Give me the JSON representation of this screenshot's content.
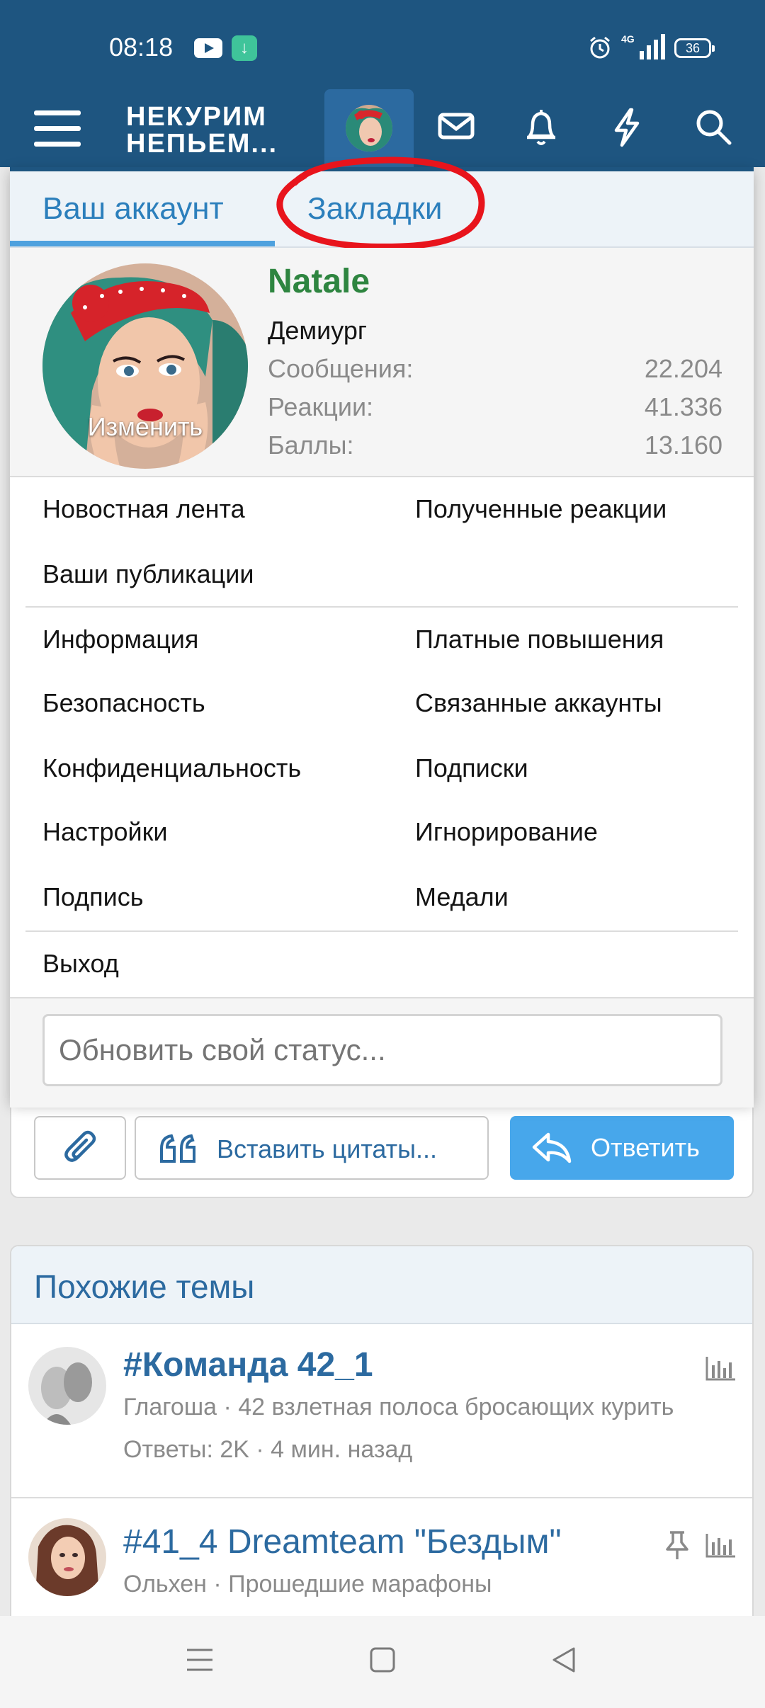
{
  "status_bar": {
    "time": "08:18",
    "battery": "36"
  },
  "header": {
    "logo_line1": "НЕКУРИМ",
    "logo_line2": "НЕПЬЕМ..."
  },
  "popup": {
    "tabs": {
      "account": "Ваш аккаунт",
      "bookmarks": "Закладки"
    },
    "profile": {
      "change_label": "Изменить",
      "username": "Natale",
      "user_title": "Демиург",
      "stats": [
        {
          "label": "Сообщения:",
          "value": "22.204"
        },
        {
          "label": "Реакции:",
          "value": "41.336"
        },
        {
          "label": "Баллы:",
          "value": "13.160"
        }
      ]
    },
    "links": {
      "news_feed": "Новостная лента",
      "reactions_received": "Полученные реакции",
      "your_posts": "Ваши публикации",
      "information": "Информация",
      "paid_upgrades": "Платные повышения",
      "security": "Безопасность",
      "connected_accounts": "Связанные аккаунты",
      "privacy": "Конфиденциальность",
      "subscriptions": "Подписки",
      "settings": "Настройки",
      "ignoring": "Игнорирование",
      "signature": "Подпись",
      "medals": "Медали",
      "logout": "Выход"
    },
    "status_placeholder": "Обновить свой статус..."
  },
  "reply_bar": {
    "insert_quotes": "Вставить цитаты...",
    "reply": "Ответить"
  },
  "similar": {
    "title": "Похожие темы",
    "threads": [
      {
        "title": "#Команда 42_1",
        "meta": "Глагоша · 42 взлетная полоса бросающих курить",
        "meta2": "Ответы: 2K · 4 мин. назад"
      },
      {
        "title": "#41_4 Dreamteam \"Бездым\"",
        "meta": "Ольхен · Прошедшие марафоны"
      }
    ]
  },
  "colors": {
    "header": "#1e5580",
    "accent": "#2c7fbc",
    "username": "#2e8540",
    "reply_button": "#47a7eb",
    "annotation": "#e8141c"
  }
}
